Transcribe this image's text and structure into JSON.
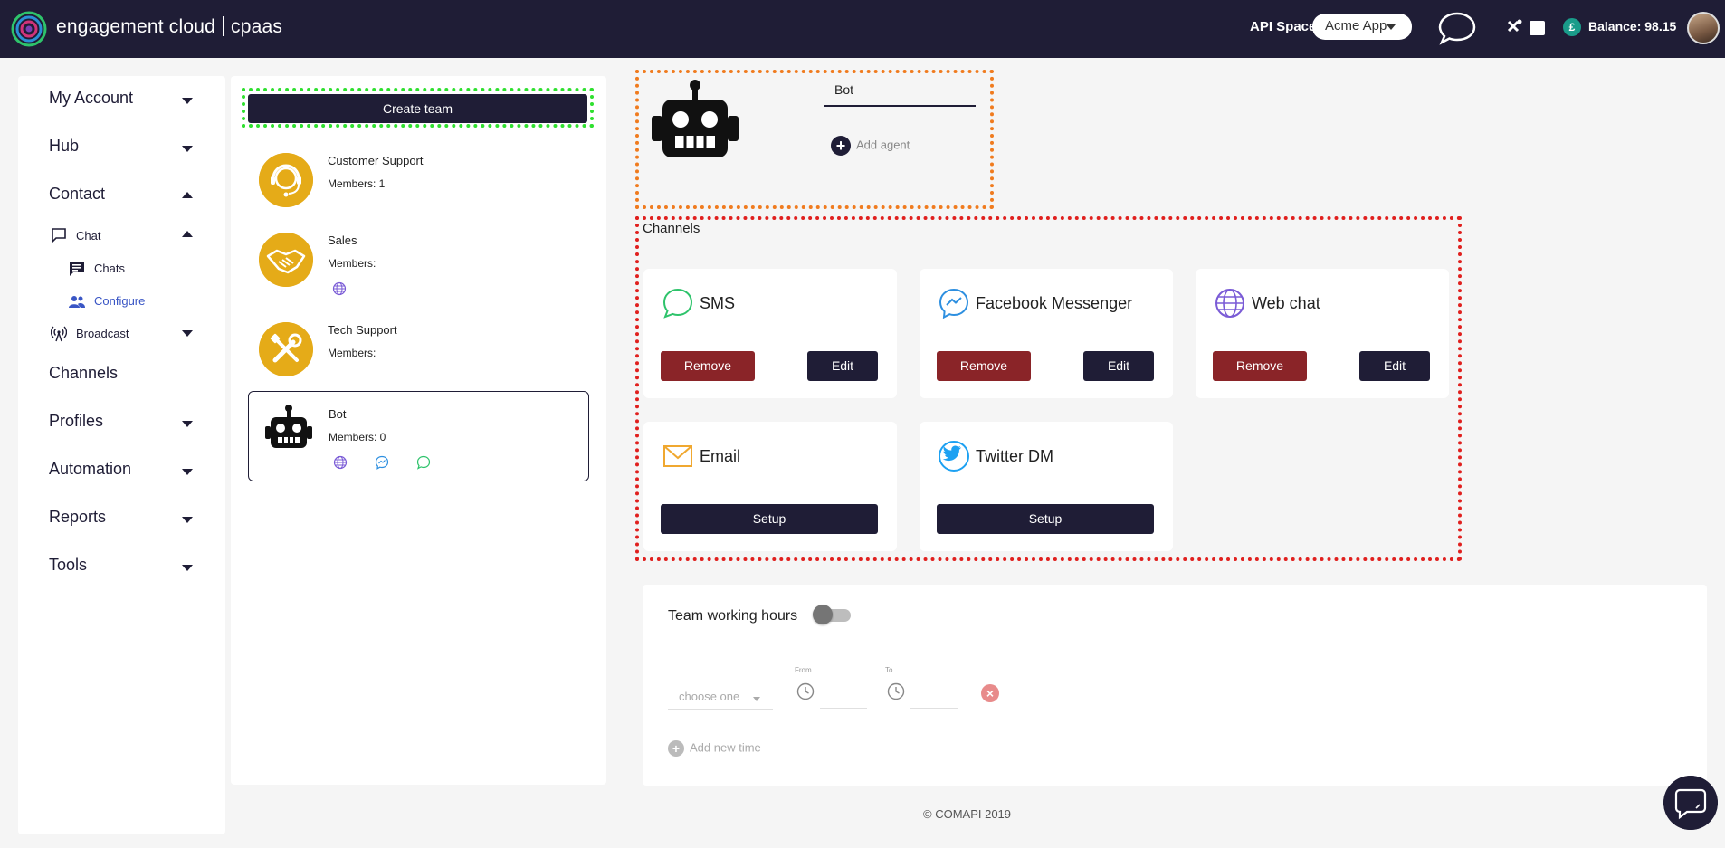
{
  "app": {
    "brand_name": "engagement cloud",
    "brand_product": "cpaas",
    "api_space_label": "API Space:",
    "api_space_value": "Acme App",
    "currency_symbol": "£",
    "balance": "Balance: 98.15"
  },
  "sidebar": {
    "my_account": "My Account",
    "hub": "Hub",
    "contact": "Contact",
    "chat": "Chat",
    "chats": "Chats",
    "configure": "Configure",
    "broadcast": "Broadcast",
    "channels": "Channels",
    "profiles": "Profiles",
    "automation": "Automation",
    "reports": "Reports",
    "tools": "Tools"
  },
  "teams": {
    "create_label": "Create team",
    "items": [
      {
        "name": "Customer Support",
        "members": "Members: 1",
        "icon": "headset-agent-icon"
      },
      {
        "name": "Sales",
        "members": "Members:",
        "icon": "handshake-icon"
      },
      {
        "name": "Tech Support",
        "members": "Members:",
        "icon": "tools-icon"
      },
      {
        "name": "Bot",
        "members": "Members: 0",
        "icon": "robot-icon"
      }
    ]
  },
  "bot": {
    "name_value": "Bot",
    "add_agent": "Add agent"
  },
  "channels": {
    "title": "Channels",
    "cards": [
      {
        "name": "SMS",
        "icon": "sms-bubble-icon",
        "primary": "Remove",
        "secondary": "Edit"
      },
      {
        "name": "Facebook Messenger",
        "icon": "messenger-icon",
        "primary": "Remove",
        "secondary": "Edit"
      },
      {
        "name": "Web chat",
        "icon": "globe-icon",
        "primary": "Remove",
        "secondary": "Edit"
      },
      {
        "name": "Email",
        "icon": "envelope-icon",
        "action": "Setup"
      },
      {
        "name": "Twitter DM",
        "icon": "twitter-icon",
        "action": "Setup"
      }
    ]
  },
  "hours": {
    "title": "Team working hours",
    "choose_placeholder": "choose one",
    "from_label": "From",
    "to_label": "To",
    "add_time": "Add new time"
  },
  "footer": {
    "copyright": "© COMAPI 2019"
  },
  "colors": {
    "navy": "#1f1d36",
    "remove_red": "#8a2428",
    "team_gold": "#e5ab18",
    "active_blue": "#3a56c5",
    "highlight_green": "#2fe02f",
    "highlight_orange": "#f07b1e",
    "highlight_red": "#e0201e"
  }
}
